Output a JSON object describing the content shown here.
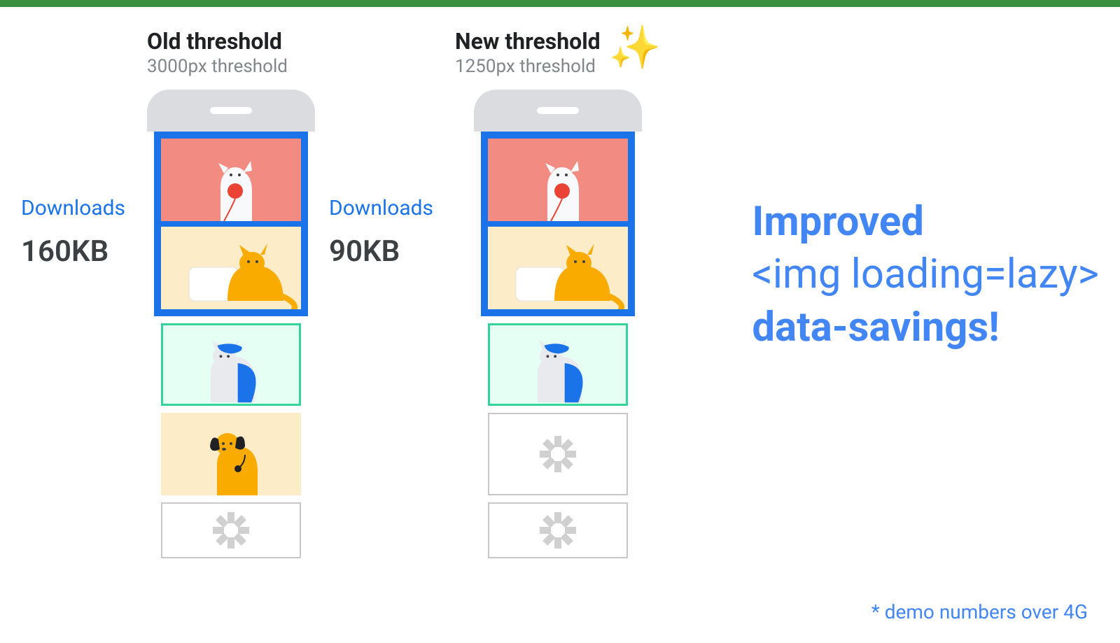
{
  "columns": [
    {
      "downloads_label": "Downloads",
      "downloads_value": "160KB",
      "title": "Old threshold",
      "subtitle": "3000px threshold"
    },
    {
      "downloads_label": "Downloads",
      "downloads_value": "90KB",
      "title": "New threshold",
      "subtitle": "1250px threshold"
    }
  ],
  "sparkle": "✨",
  "message": {
    "line1_bold": "Improved",
    "line2": "<img loading=lazy>",
    "line3_bold": "data-savings!"
  },
  "footnote": "* demo numbers over 4G"
}
